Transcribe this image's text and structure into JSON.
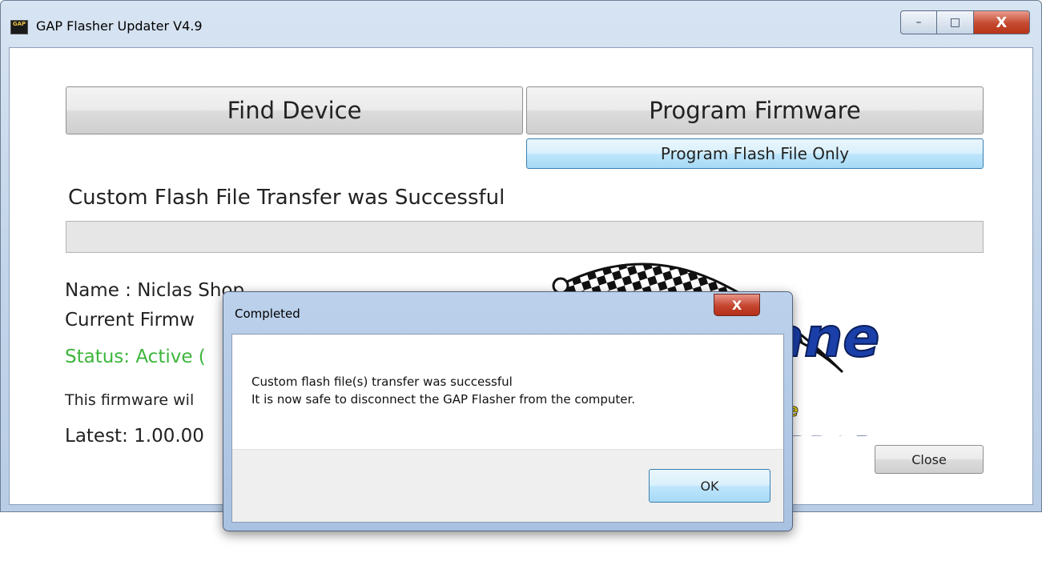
{
  "window": {
    "title": "GAP Flasher Updater V4.9",
    "icon_text": "GAP\nFLASHER",
    "controls": {
      "minimize": "–",
      "maximize": "□",
      "close": "X"
    }
  },
  "toolbar": {
    "find_device": "Find Device",
    "program_firmware": "Program Firmware",
    "program_flash_only": "Program Flash File Only"
  },
  "status_message": "Custom Flash File Transfer was Successful",
  "progress": {
    "value": 0
  },
  "device": {
    "name": "Name : Niclas Shop",
    "current_firmware": "Current Firmw",
    "status": "Status: Active (",
    "note": "This firmware wil",
    "latest": "Latest: 1.00.00"
  },
  "buttons": {
    "close": "Close"
  },
  "dialog": {
    "title": "Completed",
    "close_glyph": "X",
    "line1": "Custom flash file(s) transfer was successful",
    "line2": "It is now safe to disconnect the GAP Flasher from the computer.",
    "ok": "OK"
  },
  "colors": {
    "status_green": "#3cb63c",
    "titlebar": "#c3d5ea",
    "close_red": "#c44a30",
    "logo_blue": "#1a3fa8",
    "logo_yellow": "#e8d21a"
  }
}
